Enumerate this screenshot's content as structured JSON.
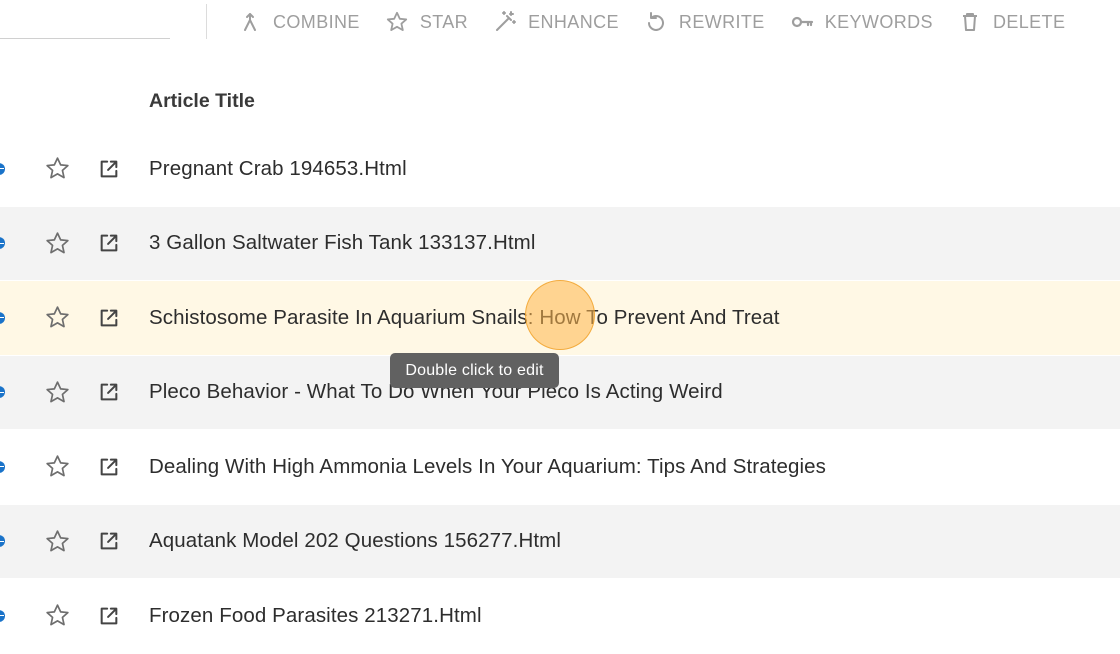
{
  "toolbar": {
    "buttons": [
      {
        "label": "COMBINE",
        "icon": "merge-icon"
      },
      {
        "label": "STAR",
        "icon": "star-outline-icon"
      },
      {
        "label": "ENHANCE",
        "icon": "magic-wand-icon"
      },
      {
        "label": "REWRITE",
        "icon": "rotate-icon"
      },
      {
        "label": "KEYWORDS",
        "icon": "key-icon"
      },
      {
        "label": "DELETE",
        "icon": "trash-icon"
      }
    ]
  },
  "table": {
    "column_title": "Article Title",
    "rows": [
      {
        "title": "Pregnant Crab 194653.Html"
      },
      {
        "title": "3 Gallon Saltwater Fish Tank 133137.Html"
      },
      {
        "title": "Schistosome Parasite In Aquarium Snails: How To Prevent And Treat"
      },
      {
        "title": "Pleco Behavior - What To Do When Your Pleco Is Acting Weird"
      },
      {
        "title": "Dealing With High Ammonia Levels In Your Aquarium: Tips And Strategies"
      },
      {
        "title": "Aquatank Model 202 Questions 156277.Html"
      },
      {
        "title": "Frozen Food Parasites 213271.Html"
      }
    ]
  },
  "tooltip": {
    "text": "Double click to edit"
  },
  "colors": {
    "toolbar_text": "#9e9e9e",
    "row_alt": "#f3f3f3",
    "row_highlight": "#fff8e5",
    "tooltip_bg": "#616161",
    "globe": "#1a73c9"
  }
}
